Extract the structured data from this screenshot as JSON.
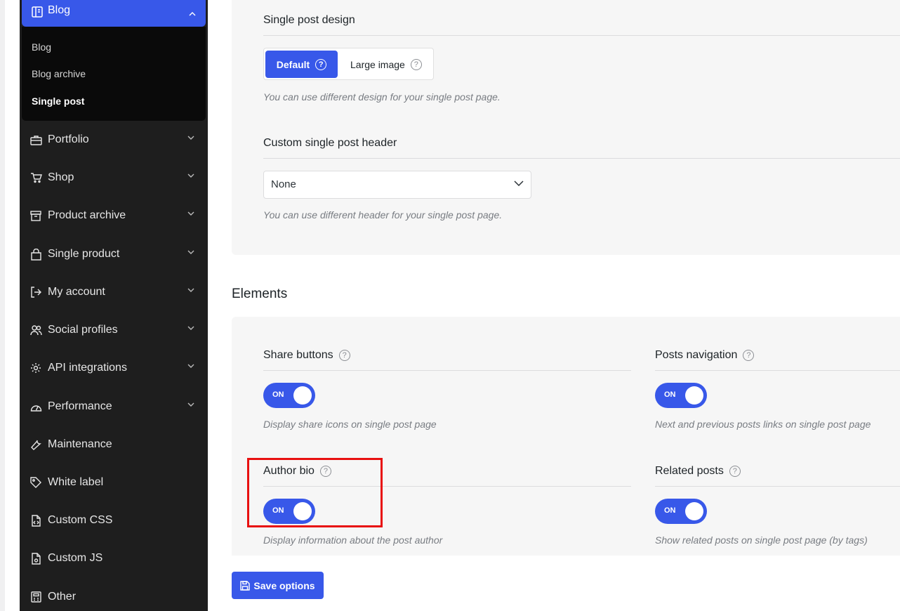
{
  "sidebar": {
    "blog_header": "Blog",
    "submenu": [
      "Blog",
      "Blog archive",
      "Single post"
    ],
    "items": [
      {
        "label": "Portfolio",
        "icon": "briefcase-icon"
      },
      {
        "label": "Shop",
        "icon": "cart-icon"
      },
      {
        "label": "Product archive",
        "icon": "archive-icon"
      },
      {
        "label": "Single product",
        "icon": "bag-icon"
      },
      {
        "label": "My account",
        "icon": "login-icon"
      },
      {
        "label": "Social profiles",
        "icon": "users-icon"
      },
      {
        "label": "API integrations",
        "icon": "gear-icon"
      },
      {
        "label": "Performance",
        "icon": "gauge-icon"
      },
      {
        "label": "Maintenance",
        "icon": "wrench-icon"
      },
      {
        "label": "White label",
        "icon": "tag-icon"
      },
      {
        "label": "Custom CSS",
        "icon": "css-file-icon"
      },
      {
        "label": "Custom JS",
        "icon": "js-file-icon"
      },
      {
        "label": "Other",
        "icon": "calculator-icon"
      }
    ]
  },
  "single_post_design": {
    "label": "Single post design",
    "options": [
      "Default",
      "Large image"
    ],
    "selected": "Default",
    "description": "You can use different design for your single post page."
  },
  "custom_header": {
    "label": "Custom single post header",
    "value": "None",
    "description": "You can use different header for your single post page."
  },
  "elements": {
    "title": "Elements",
    "share_buttons": {
      "label": "Share buttons",
      "toggle": "ON",
      "description": "Display share icons on single post page"
    },
    "posts_navigation": {
      "label": "Posts navigation",
      "toggle": "ON",
      "description": "Next and previous posts links on single post page"
    },
    "author_bio": {
      "label": "Author bio",
      "toggle": "ON",
      "description": "Display information about the post author"
    },
    "related_posts": {
      "label": "Related posts",
      "toggle": "ON",
      "description": "Show related posts on single post page (by tags)"
    }
  },
  "help_glyph": "?",
  "save_label": "Save options",
  "colors": {
    "accent": "#3858e9",
    "sidebar": "#1e1e1e",
    "highlight": "#e81010"
  }
}
